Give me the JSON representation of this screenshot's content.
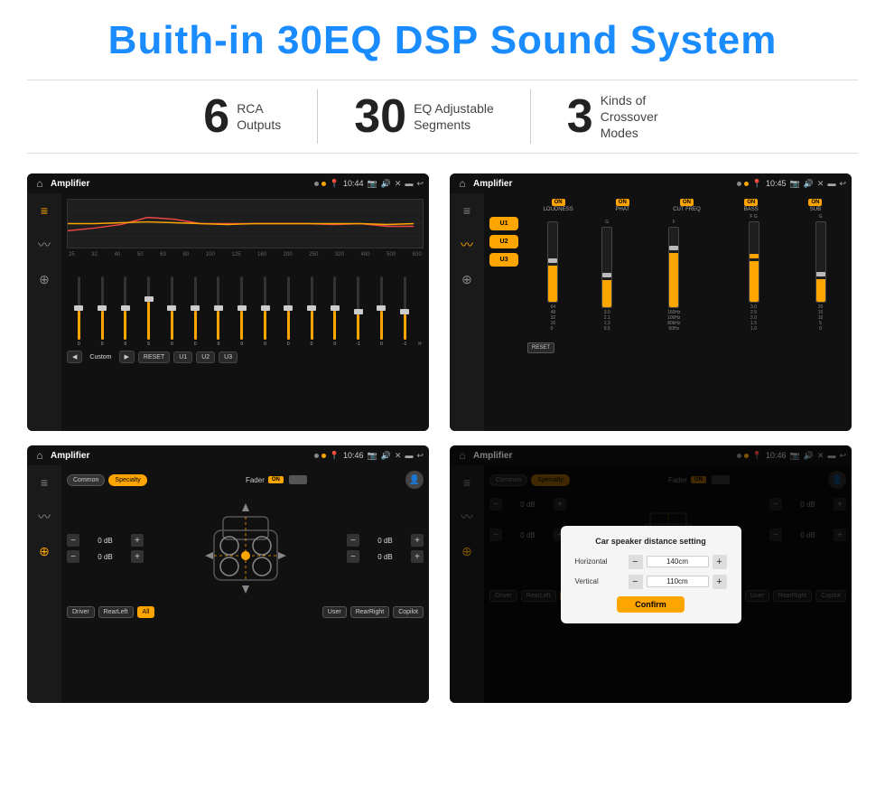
{
  "header": {
    "title": "Buith-in 30EQ DSP Sound System"
  },
  "stats": [
    {
      "number": "6",
      "label": "RCA\nOutputs"
    },
    {
      "number": "30",
      "label": "EQ Adjustable\nSegments"
    },
    {
      "number": "3",
      "label": "Kinds of\nCrossover Modes"
    }
  ],
  "screens": {
    "eq": {
      "app_name": "Amplifier",
      "time": "10:44",
      "eq_bands": [
        "25",
        "32",
        "40",
        "50",
        "63",
        "80",
        "100",
        "125",
        "160",
        "200",
        "250",
        "320",
        "400",
        "500",
        "630"
      ],
      "eq_values": [
        "0",
        "0",
        "0",
        "5",
        "0",
        "0",
        "0",
        "0",
        "0",
        "0",
        "0",
        "0",
        "-1",
        "0",
        "-1"
      ],
      "buttons": [
        "Custom",
        "RESET",
        "U1",
        "U2",
        "U3"
      ]
    },
    "crossover": {
      "app_name": "Amplifier",
      "time": "10:45",
      "presets": [
        "U1",
        "U2",
        "U3"
      ],
      "channels": [
        "LOUDNESS",
        "PHAT",
        "CUT FREQ",
        "BASS",
        "SUB"
      ],
      "reset_label": "RESET"
    },
    "fader": {
      "app_name": "Amplifier",
      "time": "10:46",
      "modes": [
        "Common",
        "Specialty"
      ],
      "fader_label": "Fader",
      "on_label": "ON",
      "db_values": [
        "0 dB",
        "0 dB",
        "0 dB",
        "0 dB"
      ],
      "buttons": [
        "Driver",
        "RearLeft",
        "All",
        "User",
        "RearRight",
        "Copilot"
      ]
    },
    "dialog": {
      "app_name": "Amplifier",
      "time": "10:46",
      "modes": [
        "Common",
        "Specialty"
      ],
      "dialog_title": "Car speaker distance setting",
      "horizontal_label": "Horizontal",
      "horizontal_value": "140cm",
      "vertical_label": "Vertical",
      "vertical_value": "110cm",
      "confirm_label": "Confirm",
      "db_values": [
        "0 dB",
        "0 dB"
      ],
      "buttons": [
        "Driver",
        "RearLeft",
        "All",
        "User",
        "RearRight",
        "Copilot"
      ]
    }
  },
  "colors": {
    "accent": "#ffa500",
    "blue_title": "#1a8cff",
    "bg_dark": "#111111",
    "text_light": "#cccccc"
  }
}
